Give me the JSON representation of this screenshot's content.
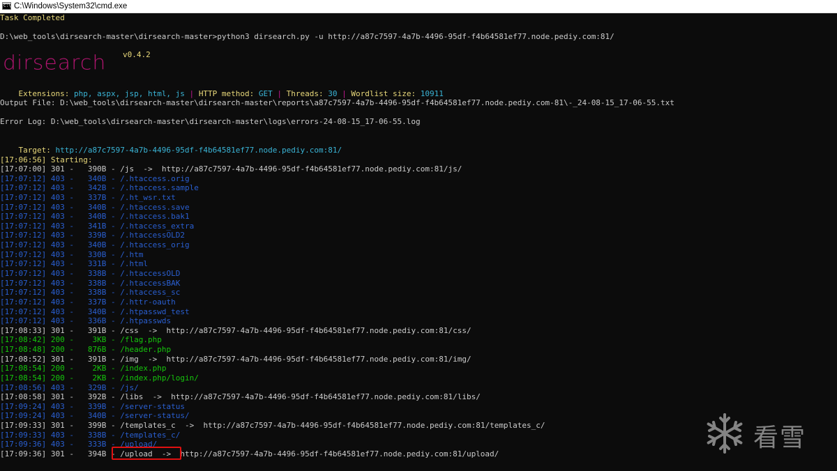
{
  "window": {
    "title": "C:\\Windows\\System32\\cmd.exe"
  },
  "console": {
    "task_completed": "Task Completed",
    "command": "D:\\web_tools\\dirsearch-master\\dirsearch-master>python3 dirsearch.py -u http://a87c7597-4a7b-4496-95df-f4b64581ef77.node.pediy.com:81/",
    "logo": "dirsearch",
    "version": "v0.4.2",
    "config": {
      "ext_label": "Extensions: ",
      "ext_value": "php, aspx, jsp, html, js",
      "sep": " | ",
      "method_label": "HTTP method: ",
      "method_value": "GET",
      "threads_label": "Threads: ",
      "threads_value": "30",
      "wordlist_label": "Wordlist size: ",
      "wordlist_value": "10911"
    },
    "output_file": "Output File: D:\\web_tools\\dirsearch-master\\dirsearch-master\\reports\\a87c7597-4a7b-4496-95df-f4b64581ef77.node.pediy.com-81\\-_24-08-15_17-06-55.txt",
    "error_log": "Error Log: D:\\web_tools\\dirsearch-master\\dirsearch-master\\logs\\errors-24-08-15_17-06-55.log",
    "target_label": "Target: ",
    "target_url": "http://a87c7597-4a7b-4496-95df-f4b64581ef77.node.pediy.com:81/",
    "starting": "[17:06:56] Starting:",
    "results": [
      {
        "time": "[17:07:00]",
        "code": "301",
        "size": "  390B",
        "path": "/js",
        "redirect": "http://a87c7597-4a7b-4496-95df-f4b64581ef77.node.pediy.com:81/js/",
        "color": "grey"
      },
      {
        "time": "[17:07:12]",
        "code": "403",
        "size": "  340B",
        "path": "/.htaccess.orig",
        "color": "blue"
      },
      {
        "time": "[17:07:12]",
        "code": "403",
        "size": "  342B",
        "path": "/.htaccess.sample",
        "color": "blue"
      },
      {
        "time": "[17:07:12]",
        "code": "403",
        "size": "  337B",
        "path": "/.ht_wsr.txt",
        "color": "blue"
      },
      {
        "time": "[17:07:12]",
        "code": "403",
        "size": "  340B",
        "path": "/.htaccess.save",
        "color": "blue"
      },
      {
        "time": "[17:07:12]",
        "code": "403",
        "size": "  340B",
        "path": "/.htaccess.bak1",
        "color": "blue"
      },
      {
        "time": "[17:07:12]",
        "code": "403",
        "size": "  341B",
        "path": "/.htaccess_extra",
        "color": "blue"
      },
      {
        "time": "[17:07:12]",
        "code": "403",
        "size": "  339B",
        "path": "/.htaccessOLD2",
        "color": "blue"
      },
      {
        "time": "[17:07:12]",
        "code": "403",
        "size": "  340B",
        "path": "/.htaccess_orig",
        "color": "blue"
      },
      {
        "time": "[17:07:12]",
        "code": "403",
        "size": "  330B",
        "path": "/.htm",
        "color": "blue"
      },
      {
        "time": "[17:07:12]",
        "code": "403",
        "size": "  331B",
        "path": "/.html",
        "color": "blue"
      },
      {
        "time": "[17:07:12]",
        "code": "403",
        "size": "  338B",
        "path": "/.htaccessOLD",
        "color": "blue"
      },
      {
        "time": "[17:07:12]",
        "code": "403",
        "size": "  338B",
        "path": "/.htaccessBAK",
        "color": "blue"
      },
      {
        "time": "[17:07:12]",
        "code": "403",
        "size": "  338B",
        "path": "/.htaccess_sc",
        "color": "blue"
      },
      {
        "time": "[17:07:12]",
        "code": "403",
        "size": "  337B",
        "path": "/.httr-oauth",
        "color": "blue"
      },
      {
        "time": "[17:07:12]",
        "code": "403",
        "size": "  340B",
        "path": "/.htpasswd_test",
        "color": "blue"
      },
      {
        "time": "[17:07:12]",
        "code": "403",
        "size": "  336B",
        "path": "/.htpasswds",
        "color": "blue"
      },
      {
        "time": "[17:08:33]",
        "code": "301",
        "size": "  391B",
        "path": "/css",
        "redirect": "http://a87c7597-4a7b-4496-95df-f4b64581ef77.node.pediy.com:81/css/",
        "color": "grey"
      },
      {
        "time": "[17:08:42]",
        "code": "200",
        "size": "   3KB",
        "path": "/flag.php",
        "color": "green"
      },
      {
        "time": "[17:08:48]",
        "code": "200",
        "size": "  876B",
        "path": "/header.php",
        "color": "green"
      },
      {
        "time": "[17:08:52]",
        "code": "301",
        "size": "  391B",
        "path": "/img",
        "redirect": "http://a87c7597-4a7b-4496-95df-f4b64581ef77.node.pediy.com:81/img/",
        "color": "grey"
      },
      {
        "time": "[17:08:54]",
        "code": "200",
        "size": "   2KB",
        "path": "/index.php",
        "color": "green"
      },
      {
        "time": "[17:08:54]",
        "code": "200",
        "size": "   2KB",
        "path": "/index.php/login/",
        "color": "green"
      },
      {
        "time": "[17:08:56]",
        "code": "403",
        "size": "  329B",
        "path": "/js/",
        "color": "blue"
      },
      {
        "time": "[17:08:58]",
        "code": "301",
        "size": "  392B",
        "path": "/libs",
        "redirect": "http://a87c7597-4a7b-4496-95df-f4b64581ef77.node.pediy.com:81/libs/",
        "color": "grey"
      },
      {
        "time": "[17:09:24]",
        "code": "403",
        "size": "  339B",
        "path": "/server-status",
        "color": "blue"
      },
      {
        "time": "[17:09:24]",
        "code": "403",
        "size": "  340B",
        "path": "/server-status/",
        "color": "blue"
      },
      {
        "time": "[17:09:33]",
        "code": "301",
        "size": "  399B",
        "path": "/templates_c",
        "redirect": "http://a87c7597-4a7b-4496-95df-f4b64581ef77.node.pediy.com:81/templates_c/",
        "color": "grey"
      },
      {
        "time": "[17:09:33]",
        "code": "403",
        "size": "  338B",
        "path": "/templates_c/",
        "color": "blue"
      },
      {
        "time": "[17:09:36]",
        "code": "403",
        "size": "  333B",
        "path": "/upload/",
        "color": "blue"
      },
      {
        "time": "[17:09:36]",
        "code": "301",
        "size": "  394B",
        "path": "/upload",
        "redirect": "http://a87c7597-4a7b-4496-95df-f4b64581ef77.node.pediy.com:81/upload/",
        "color": "grey"
      }
    ]
  },
  "watermark": {
    "text": "看雪",
    "icon": "snowflake-icon"
  },
  "colors": {
    "background": "#0c0c0c",
    "default_text": "#cccccc",
    "status_yellow": "#e8d87a",
    "info_cyan": "#3ab4d6",
    "forbidden_blue": "#2a5fd1",
    "ok_green": "#16c60c",
    "logo_magenta": "#b0156f",
    "highlight_red": "#e01010"
  }
}
